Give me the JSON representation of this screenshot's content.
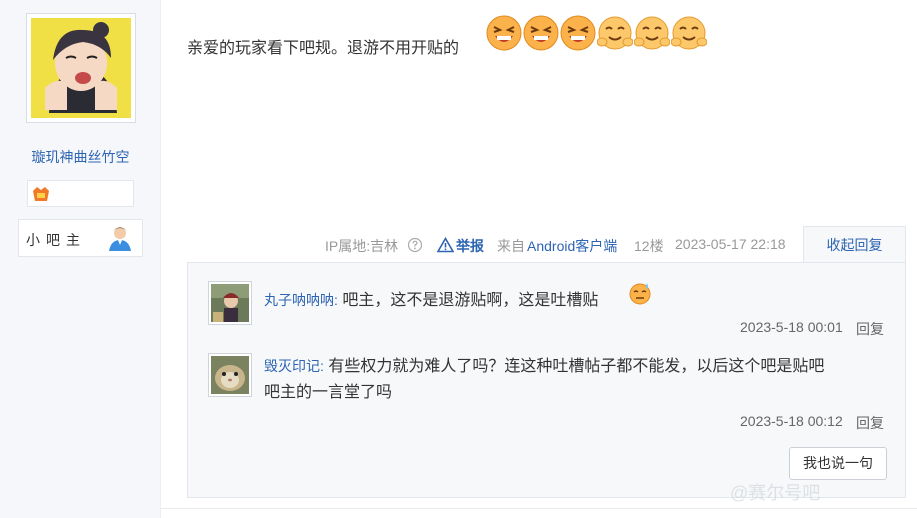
{
  "author": {
    "name": "璇玑神曲丝竹空",
    "role_label": "小吧主"
  },
  "post": {
    "text": "亲爱的玩家看下吧规。退游不用开贴的",
    "emojis": [
      "grin-emoji",
      "grin-emoji",
      "grin-emoji",
      "blush-emoji",
      "blush-emoji",
      "blush-emoji"
    ]
  },
  "meta": {
    "ip": "IP属地:吉林",
    "report": "举报",
    "source_prefix": "来自",
    "source_client": "Android客户端",
    "floor": "12楼",
    "datetime": "2023-05-17 22:18",
    "collapse": "收起回复"
  },
  "comments": [
    {
      "user": "丸子呐呐呐:",
      "text": "吧主，这不是退游贴啊，这是吐槽贴",
      "time": "2023-5-18 00:01",
      "reply": "回复"
    },
    {
      "user": "毁灭印记:",
      "text_line1": "有些权力就为难人了吗？连这种吐槽帖子都不能发，以后这个吧是贴吧",
      "text_line2": "吧主的一言堂了吗",
      "time": "2023-5-18 00:12",
      "reply": "回复"
    }
  ],
  "say_button": "我也说一句",
  "watermark": "@赛尔号吧",
  "colors": {
    "link": "#2d64b3",
    "meta": "#999999",
    "panel_bg": "#f7f8fa"
  }
}
